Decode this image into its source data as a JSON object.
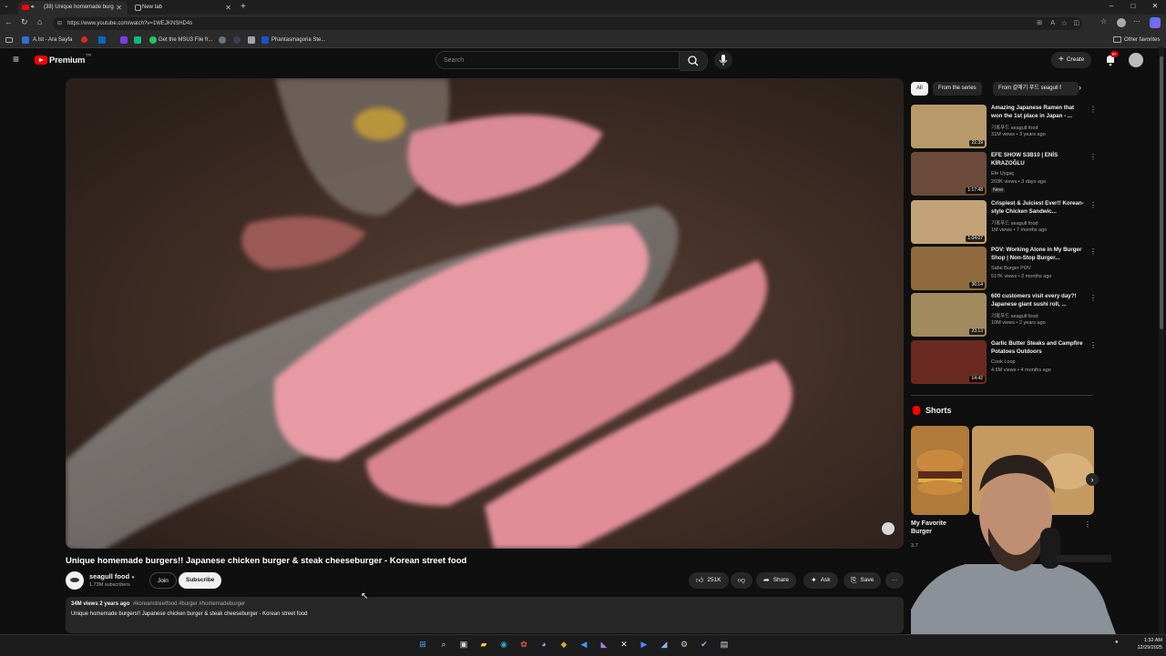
{
  "browser": {
    "tabs": [
      {
        "label": "(38) Unique homemade burg",
        "active": true
      },
      {
        "label": "New tab",
        "active": false
      }
    ],
    "new_tab_symbol": "+",
    "url": "https://www.youtube.com/watch?v=1WEJKNSHD4s",
    "bookmarks": [
      "A.Ist - Ara Sayfa",
      "Get the MSU3 File fr...",
      "Phantasmagoria Ste..."
    ],
    "other_favorites": "Other favorites",
    "window_controls": [
      "–",
      "□",
      "✕"
    ]
  },
  "youtube": {
    "logo_text": "Premium",
    "logo_sup": "TR",
    "search_placeholder": "Search",
    "create_label": "Create",
    "notification_count": "9+"
  },
  "video": {
    "title": "Unique homemade burgers!! Japanese chicken burger & steak cheeseburger - Korean street food",
    "channel": "seagull food",
    "subscribers": "1.73M subscribers",
    "join_label": "Join",
    "subscribe_label": "Subscribe",
    "likes": "251K",
    "share_label": "Share",
    "ask_label": "Ask",
    "save_label": "Save",
    "more_label": "···",
    "views_meta": "34M views  2 years ago",
    "hashtags": "#koreanstreetfood #burger #homemadeburger",
    "description": "Unique homemade burgers!! Japanese chicken burger & steak cheeseburger - Korean street food"
  },
  "sidebar": {
    "chips": [
      "All",
      "From the series",
      "From 갈매기 푸드 seagull f"
    ],
    "recommendations": [
      {
        "title": "Amazing Japanese Ramen that won the 1st place in Japan - ...",
        "channel": "기록푸드 seagull food",
        "meta": "31M views • 3 years ago",
        "duration": "21:39",
        "badge": "",
        "thumb_color": "#b89a6a"
      },
      {
        "title": "EFE SHOW S3B10 | ENİS KİRAZOĞLU",
        "channel": "Efe Uygaç",
        "meta": "203K views • 3 days ago",
        "duration": "1:17:48",
        "badge": "New",
        "thumb_color": "#6b4a3a"
      },
      {
        "title": "Crispiest & Juiciest Ever!! Korean-style Chicken Sandwic...",
        "channel": "기록푸드 seagull food",
        "meta": "1M views • 7 months ago",
        "duration": "1:04:07",
        "badge": "",
        "thumb_color": "#c2a276"
      },
      {
        "title": "POV: Working Alone in My Burger Shop | Non-Stop Burger...",
        "channel": "Safal Burger POV",
        "meta": "517K views • 2 months ago",
        "duration": "36:14",
        "badge": "",
        "thumb_color": "#8e6a3e"
      },
      {
        "title": "600 customers visit every day?! Japanese giant sushi roll, ...",
        "channel": "기록푸드 seagull food",
        "meta": "10M views • 2 years ago",
        "duration": "23:13",
        "badge": "",
        "thumb_color": "#a08a5e"
      },
      {
        "title": "Garlic Butter Steaks and Campfire Potatoes Outdoors",
        "channel": "Cook Loop",
        "meta": "4.6M views • 4 months ago",
        "duration": "14:42",
        "badge": "",
        "thumb_color": "#6a2a22"
      }
    ],
    "shorts_title": "Shorts",
    "shorts": [
      {
        "title": "My Favorite Burger",
        "meta": "3.7",
        "thumb_color": "#b07a3a"
      },
      {
        "title": "",
        "meta": "",
        "thumb_color": "#c49a62"
      }
    ]
  },
  "taskbar": {
    "time": "1:32 AM",
    "date": "12/29/2025"
  }
}
